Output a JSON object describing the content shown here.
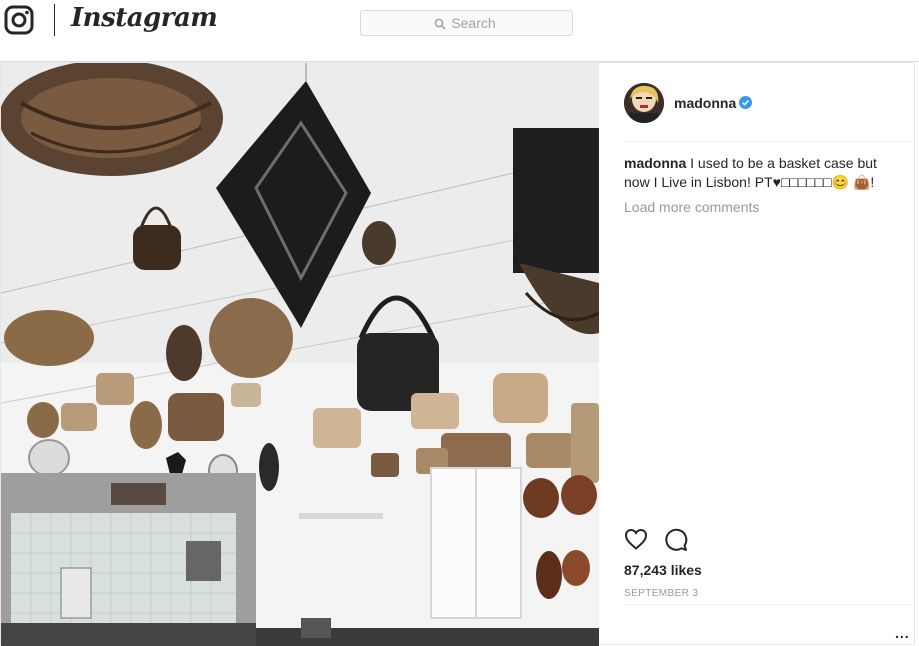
{
  "header": {
    "wordmark": "Instagram",
    "search": {
      "placeholder": "Search"
    }
  },
  "post": {
    "username": "madonna",
    "verified": true,
    "caption": {
      "username": "madonna",
      "text": "I used to be a basket case but now I Live in Lisbon! PT♥□□□□□□😊 👜!"
    },
    "load_more_label": "Load more comments",
    "likes": "87,243 likes",
    "date": "SEPTEMBER 3",
    "more_label": "..."
  },
  "icons": {
    "camera": "instagram-camera-icon",
    "search": "search-icon",
    "verified": "verified-badge-icon",
    "like": "heart-icon",
    "comment": "comment-icon"
  },
  "colors": {
    "verified": "#3897f0",
    "text": "#262626",
    "muted": "#999999",
    "border": "#dbdbdb"
  }
}
